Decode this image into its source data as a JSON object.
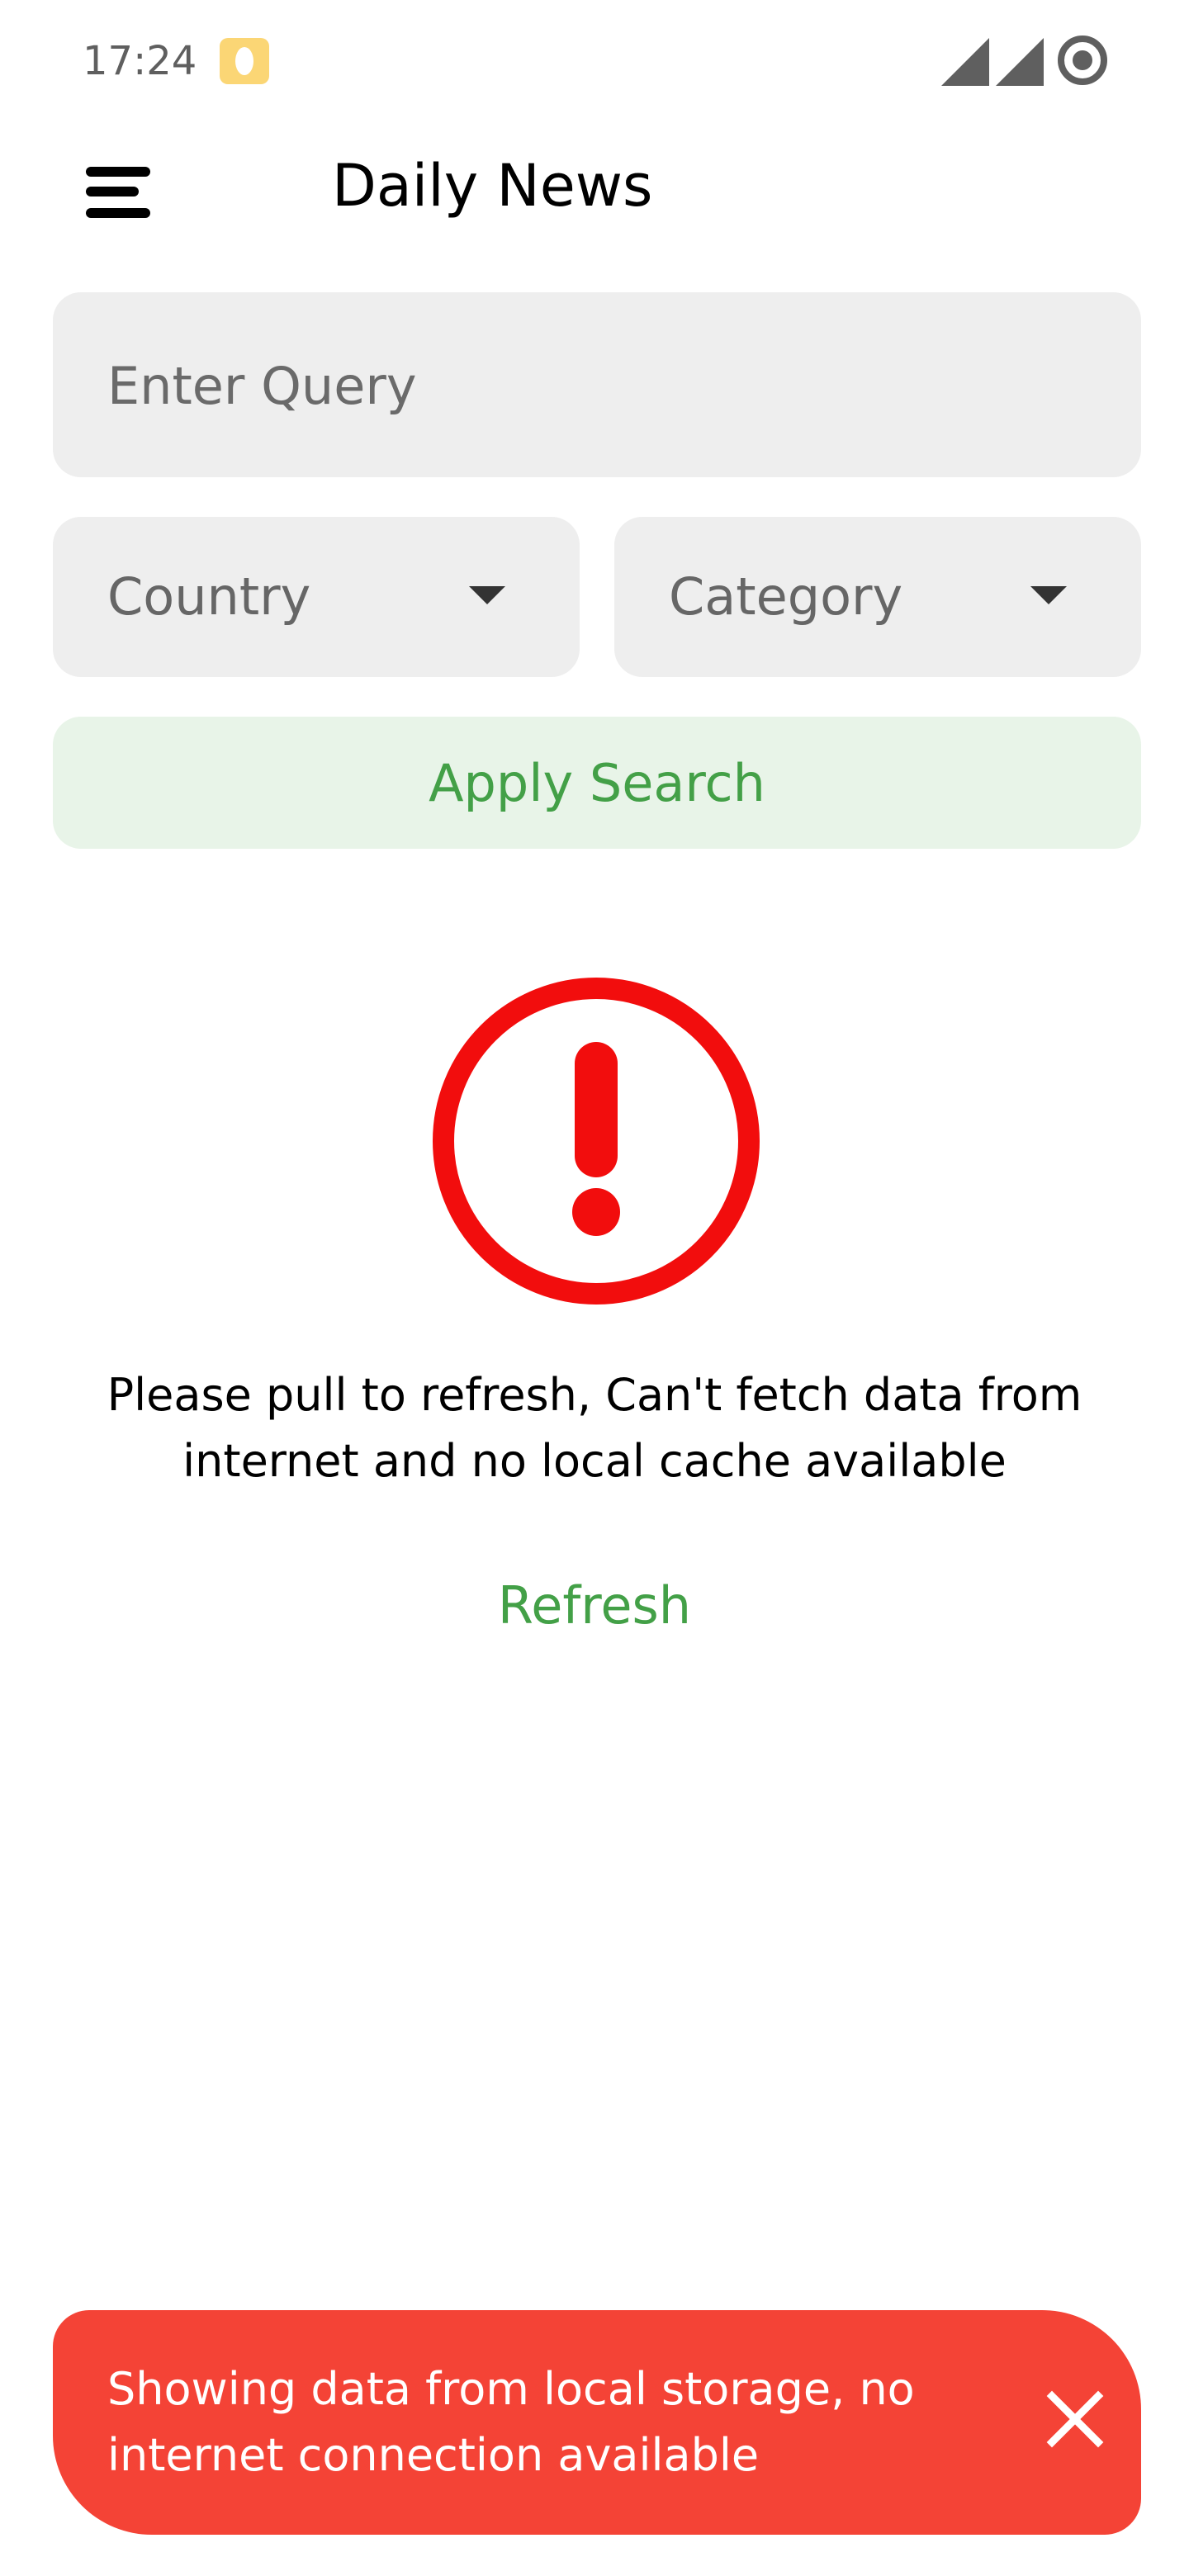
{
  "status_bar": {
    "time": "17:24",
    "icons": [
      "notification-icon",
      "signal-icon",
      "signal-icon",
      "sync-icon"
    ]
  },
  "app_bar": {
    "menu_icon": "hamburger-menu-icon",
    "title": "Daily News"
  },
  "search": {
    "query_placeholder": "Enter Query",
    "query_value": "",
    "country": {
      "label": "Country",
      "icon": "dropdown-arrow-icon"
    },
    "category": {
      "label": "Category",
      "icon": "dropdown-arrow-icon"
    },
    "apply_label": "Apply Search"
  },
  "error_state": {
    "icon": "error-exclamation-icon",
    "message": "Please pull to refresh, Can't fetch data from internet and no local cache available",
    "refresh_label": "Refresh"
  },
  "snackbar": {
    "message": "Showing data from local storage, no internet connection available",
    "close_icon": "close-icon"
  },
  "colors": {
    "accent_green": "#43a047",
    "apply_background": "#e8f4e8",
    "field_background": "#eeeeee",
    "error_red": "#f20d0d",
    "snackbar_red": "#f44336",
    "notification_yellow": "#fbd675"
  }
}
